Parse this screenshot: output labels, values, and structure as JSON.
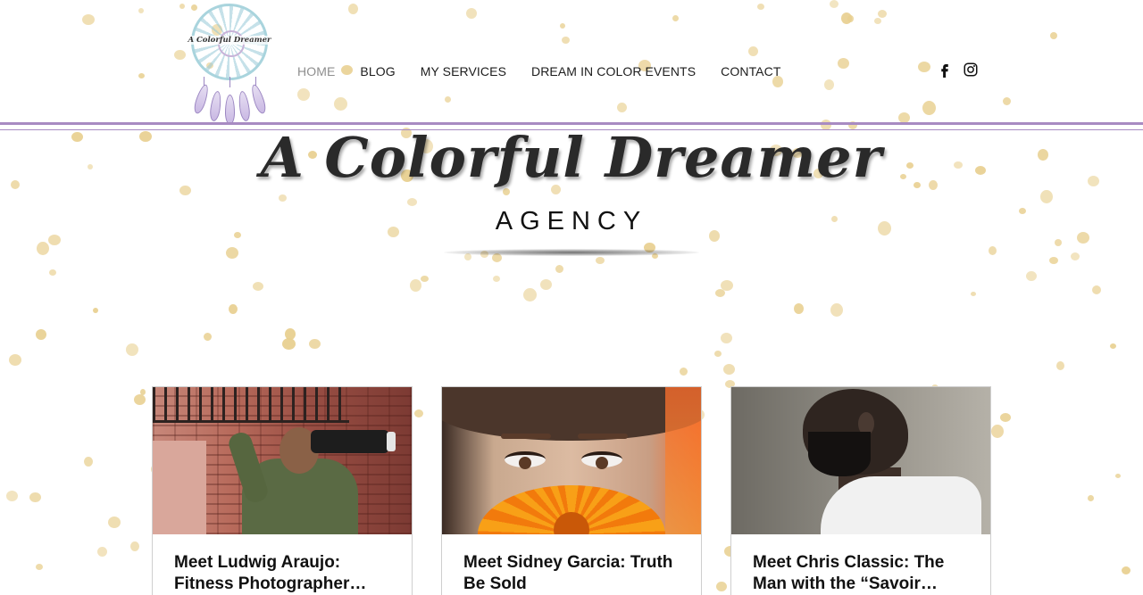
{
  "site": {
    "logo_text": "A Colorful Dreamer"
  },
  "nav": {
    "items": [
      {
        "label": "HOME",
        "active": true
      },
      {
        "label": "BLOG",
        "active": false
      },
      {
        "label": "MY SERVICES",
        "active": false
      },
      {
        "label": "DREAM IN COLOR EVENTS",
        "active": false
      },
      {
        "label": "CONTACT",
        "active": false
      }
    ]
  },
  "social": {
    "icons": [
      "facebook-icon",
      "instagram-icon"
    ]
  },
  "hero": {
    "title": "A Colorful Dreamer",
    "subtitle": "AGENCY"
  },
  "posts": [
    {
      "title": "Meet Ludwig Araujo: Fitness Photographer…",
      "image": "photographer-with-camera"
    },
    {
      "title": "Meet Sidney Garcia: Truth Be Sold",
      "image": "woman-with-orange-flower"
    },
    {
      "title": "Meet Chris Classic: The Man with the “Savoir…",
      "image": "bearded-man-profile"
    }
  ],
  "colors": {
    "accent_rule": "#a88bc2",
    "confetti": "#e8cf8f",
    "nav_active": "#8e8e8e"
  }
}
